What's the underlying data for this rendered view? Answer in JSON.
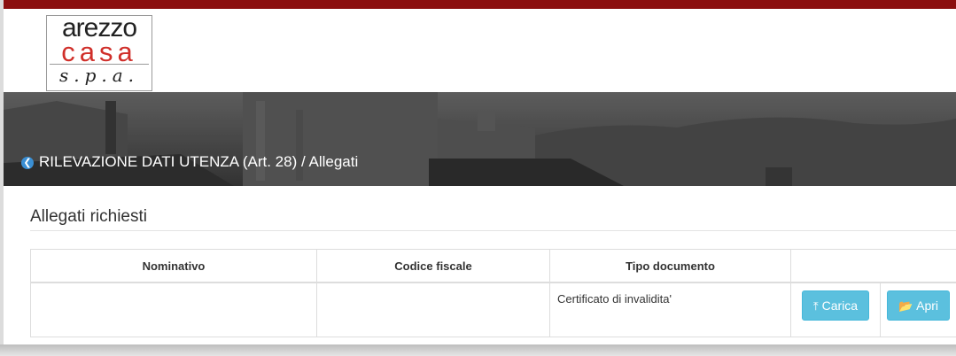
{
  "header": {
    "logo": {
      "line1": "arezzo",
      "line2": "casa",
      "line3": "s.p.a."
    },
    "brand_color": "#8b0e0e"
  },
  "banner": {
    "back_icon": "chevron-left-circle-icon",
    "breadcrumb": "RILEVAZIONE DATI UTENZA (Art. 28) / Allegati"
  },
  "section": {
    "title": "Allegati richiesti"
  },
  "table": {
    "headers": [
      "Nominativo",
      "Codice fiscale",
      "Tipo documento",
      ""
    ],
    "rows": [
      {
        "nominativo": "",
        "codice_fiscale": "",
        "tipo_documento": "Certificato di invalidita'",
        "carica_label": "Carica",
        "carica_icon": "upload-circle-icon",
        "apri_label": "Apri",
        "apri_icon": "folder-open-icon"
      }
    ]
  },
  "colors": {
    "button_info": "#5bc0de",
    "back_icon": "#3a8fd4"
  }
}
